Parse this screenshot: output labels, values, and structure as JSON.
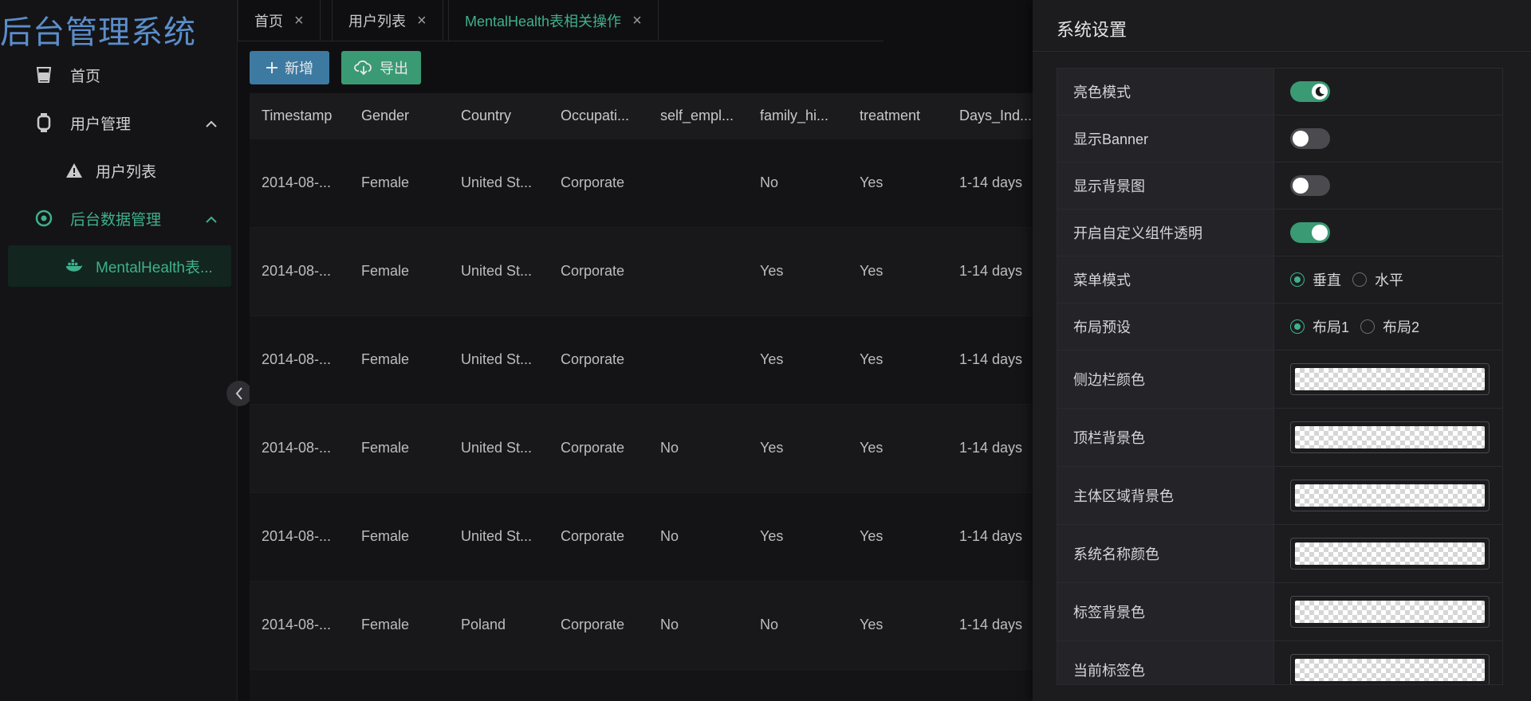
{
  "app": {
    "title": "后台管理系统"
  },
  "sidebar": {
    "items": [
      {
        "label": "首页"
      },
      {
        "label": "用户管理"
      },
      {
        "label": "用户列表"
      },
      {
        "label": "后台数据管理"
      },
      {
        "label": "MentalHealth表..."
      }
    ]
  },
  "tabs": [
    {
      "label": "首页"
    },
    {
      "label": "用户列表"
    },
    {
      "label": "MentalHealth表相关操作"
    }
  ],
  "toolbar": {
    "add_label": "新增",
    "export_label": "导出"
  },
  "table": {
    "headers": [
      "Timestamp",
      "Gender",
      "Country",
      "Occupati...",
      "self_empl...",
      "family_hi...",
      "treatment",
      "Days_Ind..."
    ],
    "rows": [
      [
        "2014-08-...",
        "Female",
        "United St...",
        "Corporate",
        "",
        "No",
        "Yes",
        "1-14 days"
      ],
      [
        "2014-08-...",
        "Female",
        "United St...",
        "Corporate",
        "",
        "Yes",
        "Yes",
        "1-14 days"
      ],
      [
        "2014-08-...",
        "Female",
        "United St...",
        "Corporate",
        "",
        "Yes",
        "Yes",
        "1-14 days"
      ],
      [
        "2014-08-...",
        "Female",
        "United St...",
        "Corporate",
        "No",
        "Yes",
        "Yes",
        "1-14 days"
      ],
      [
        "2014-08-...",
        "Female",
        "United St...",
        "Corporate",
        "No",
        "Yes",
        "Yes",
        "1-14 days"
      ],
      [
        "2014-08-...",
        "Female",
        "Poland",
        "Corporate",
        "No",
        "No",
        "Yes",
        "1-14 days"
      ]
    ]
  },
  "settings": {
    "title": "系统设置",
    "rows": [
      {
        "label": "亮色模式",
        "switch_on": true
      },
      {
        "label": "显示Banner",
        "switch_on": false
      },
      {
        "label": "显示背景图",
        "switch_on": false
      },
      {
        "label": "开启自定义组件透明",
        "switch_on": true
      },
      {
        "label": "菜单模式",
        "options": [
          "垂直",
          "水平"
        ],
        "selected": "垂直"
      },
      {
        "label": "布局预设",
        "options": [
          "布局1",
          "布局2"
        ],
        "selected": "布局1"
      },
      {
        "label": "侧边栏颜色"
      },
      {
        "label": "顶栏背景色"
      },
      {
        "label": "主体区域背景色"
      },
      {
        "label": "系统名称颜色"
      },
      {
        "label": "标签背景色"
      },
      {
        "label": "当前标签色"
      }
    ]
  },
  "colors": {
    "accent": "#3fb08c",
    "add_button": "#3d7aa1",
    "export_button": "#3a9a73",
    "system_title": "#5b8ecb"
  }
}
